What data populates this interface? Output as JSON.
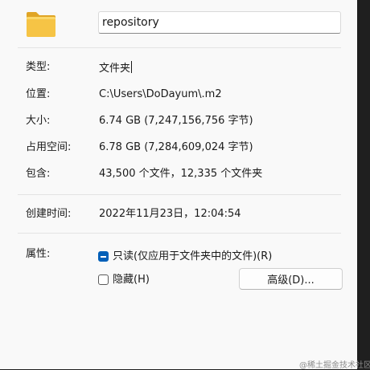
{
  "header": {
    "name_value": "repository",
    "icon": "folder-icon"
  },
  "properties": {
    "type": {
      "label": "类型:",
      "value": "文件夹"
    },
    "location": {
      "label": "位置:",
      "value": "C:\\Users\\DoDayum\\.m2"
    },
    "size": {
      "label": "大小:",
      "value": "6.74 GB (7,247,156,756 字节)"
    },
    "size_on_disk": {
      "label": "占用空间:",
      "value": "6.78 GB (7,284,609,024 字节)"
    },
    "contains": {
      "label": "包含:",
      "value": "43,500 个文件，12,335 个文件夹"
    },
    "created": {
      "label": "创建时间:",
      "value": "2022年11月23日，12:04:54"
    }
  },
  "attributes": {
    "label": "属性:",
    "readonly_label": "只读(仅应用于文件夹中的文件)(R)",
    "readonly_state": "indeterminate",
    "hidden_label": "隐藏(H)",
    "hidden_checked": false,
    "advanced_button_label": "高级(D)..."
  },
  "watermark": "@稀土掘金技术社区",
  "colors": {
    "accent": "#005fb8",
    "folder_body": "#f6c445",
    "folder_back": "#e0a526",
    "panel_bg": "#f9f9f9",
    "scrollbar_bg": "#1f1f1f"
  }
}
